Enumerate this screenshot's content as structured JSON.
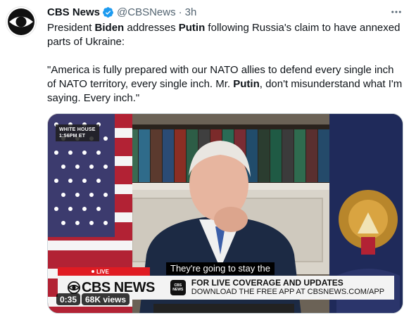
{
  "tweet": {
    "author_name": "CBS News",
    "handle": "@CBSNews",
    "separator": "·",
    "time": "3h",
    "more_icon": "more-horizontal-icon",
    "text_parts": {
      "p1_a": "President ",
      "p1_b": "Biden",
      "p1_c": " addresses ",
      "p1_d": "Putin",
      "p1_e": " following Russia's claim to have annexed parts of Ukraine:",
      "p2_a": "\"America is fully prepared with our NATO allies to defend every single inch of NATO territory, every single inch. Mr. ",
      "p2_b": "Putin",
      "p2_c": ", don't misunderstand what I'm saying. Every inch.\""
    }
  },
  "video": {
    "badge_line1": "WHITE HOUSE",
    "badge_line2": "1:56PM ET",
    "caption": "They're going to stay the",
    "live_label": "LIVE",
    "lower_third_brand": "CBS NEWS",
    "app_icon_line1": "CBS",
    "app_icon_line2": "NEWS",
    "promo_line1": "FOR LIVE COVERAGE AND UPDATES",
    "promo_line2": "DOWNLOAD THE FREE APP AT CBSNEWS.COM/APP",
    "duration": "0:35",
    "views": "68K views"
  },
  "colors": {
    "verified": "#1d9bf0",
    "live_red": "#e01b22",
    "secondary_text": "#536471"
  }
}
